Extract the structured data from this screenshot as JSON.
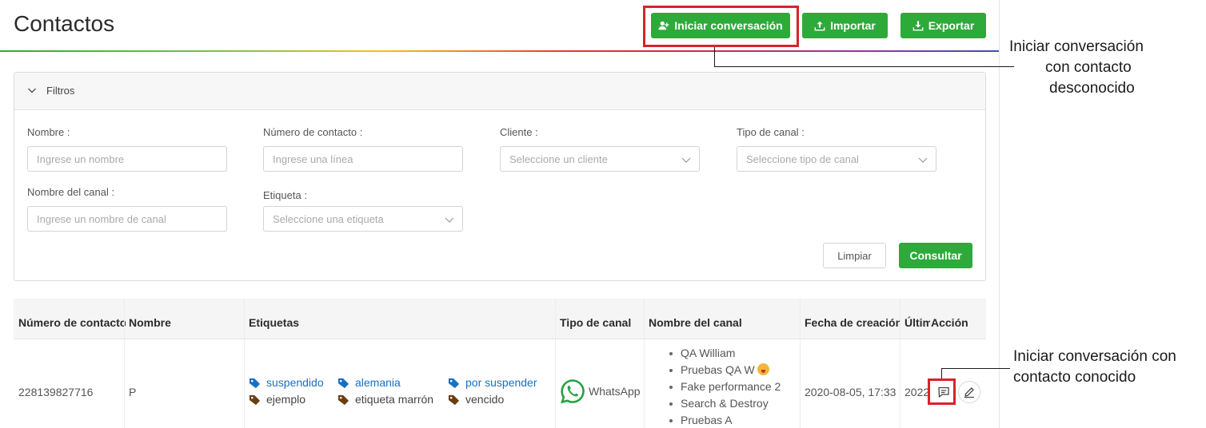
{
  "page": {
    "title": "Contactos"
  },
  "toolbar": {
    "start_conversation_label": "Iniciar conversación",
    "import_label": "Importar",
    "export_label": "Exportar"
  },
  "filters": {
    "header": "Filtros",
    "name": {
      "label": "Nombre",
      "placeholder": "Ingrese un nombre"
    },
    "contact_number": {
      "label": "Número de contacto",
      "placeholder": "Ingrese una línea"
    },
    "client": {
      "label": "Cliente",
      "placeholder": "Seleccione un cliente"
    },
    "channel_type": {
      "label": "Tipo de canal",
      "placeholder": "Seleccione tipo de canal"
    },
    "channel_name": {
      "label": "Nombre del canal",
      "placeholder": "Ingrese un nombre de canal"
    },
    "tag": {
      "label": "Etiqueta",
      "placeholder": "Seleccione una etiqueta"
    },
    "clear_label": "Limpiar",
    "submit_label": "Consultar"
  },
  "table": {
    "columns": [
      "Número de contacto",
      "Nombre",
      "Etiquetas",
      "Tipo de canal",
      "Nombre del canal",
      "Fecha de creación",
      "Últim",
      "Acción"
    ],
    "rows": [
      {
        "contact_number": "228139827716",
        "name": "P",
        "tags": [
          {
            "label": "suspendido",
            "color": "blue"
          },
          {
            "label": "alemania",
            "color": "blue"
          },
          {
            "label": "por suspender",
            "color": "blue"
          },
          {
            "label": "ejemplo",
            "color": "brown"
          },
          {
            "label": "etiqueta marrón",
            "color": "brown"
          },
          {
            "label": "vencido",
            "color": "brown"
          }
        ],
        "channel_type": "WhatsApp",
        "channel_names": [
          "QA William",
          "Pruebas QA W",
          "Fake performance 2",
          "Search & Destroy",
          "Pruebas A"
        ],
        "created_at": "2020-08-05, 17:33",
        "last": "2022"
      }
    ]
  },
  "annotations": {
    "unknown_contact": [
      "Iniciar conversación",
      "con contacto",
      "desconocido"
    ],
    "known_contact": [
      "Iniciar conversación con",
      "contacto conocido"
    ]
  },
  "colors": {
    "primary_green": "#2eaa3a",
    "highlight_red": "#d8232a",
    "tag_blue": "#1a6fc2",
    "tag_brown": "#6b3e12",
    "whatsapp_green": "#25a244"
  },
  "icons": {
    "start_conversation": "user-add-icon",
    "import": "upload-icon",
    "export": "download-icon",
    "filters_toggle": "chevron-down-icon",
    "tag": "tag-icon",
    "channel": "whatsapp-icon",
    "chat": "chat-icon",
    "edit": "edit-icon"
  }
}
